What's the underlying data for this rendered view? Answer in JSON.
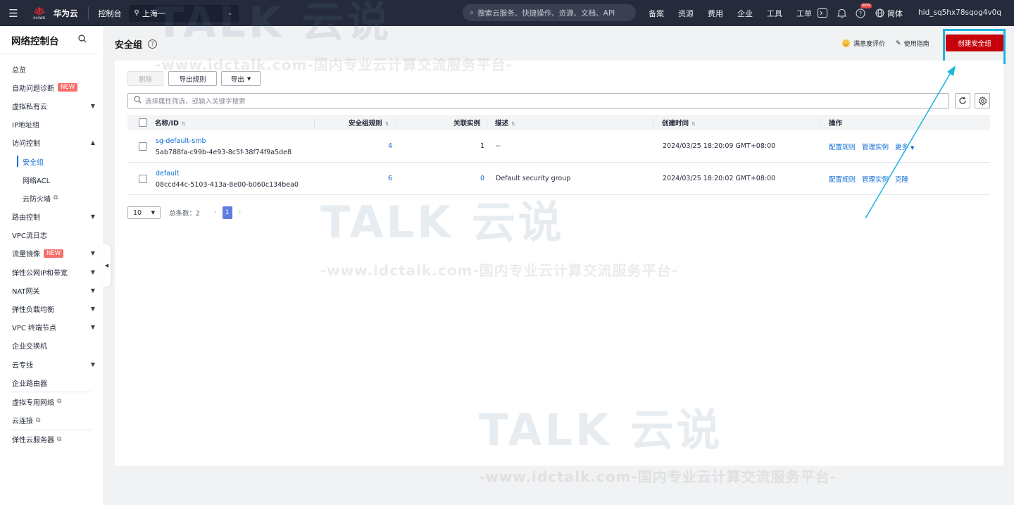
{
  "topbar": {
    "brand": "华为云",
    "logo_small": "HUAWEI",
    "console": "控制台",
    "region": "上海一",
    "search_placeholder": "搜索云服务、快捷操作、资源、文档、API",
    "links": [
      "备案",
      "资源",
      "费用",
      "企业",
      "工具",
      "工单"
    ],
    "icon_new_badge": "NEW",
    "language": "简体",
    "user": "hid_sq5hx78sqog4v0q"
  },
  "sidebar": {
    "title": "网络控制台",
    "items": [
      {
        "label": "总览"
      },
      {
        "label": "自助问题诊断",
        "badge": "NEW"
      },
      {
        "label": "虚拟私有云"
      },
      {
        "label": "IP地址组"
      },
      {
        "label": "访问控制"
      },
      {
        "label": "安全组"
      },
      {
        "label": "网络ACL"
      },
      {
        "label": "云防火墙"
      },
      {
        "label": "路由控制"
      },
      {
        "label": "VPC流日志"
      },
      {
        "label": "流量镜像",
        "badge": "NEW"
      },
      {
        "label": "弹性公网IP和带宽"
      },
      {
        "label": "NAT网关"
      },
      {
        "label": "弹性负载均衡"
      },
      {
        "label": "VPC 终端节点"
      },
      {
        "label": "企业交换机"
      },
      {
        "label": "云专线"
      },
      {
        "label": "企业路由器"
      },
      {
        "label": "虚拟专用网络"
      },
      {
        "label": "云连接"
      },
      {
        "label": "弹性云服务器"
      }
    ]
  },
  "page": {
    "title": "安全组",
    "satisfaction": "满意度评价",
    "guide": "使用指南",
    "create_button": "创建安全组"
  },
  "toolbar": {
    "delete": "删除",
    "export_rules": "导出规则",
    "export": "导出",
    "search_placeholder": "选择属性筛选，或输入关键字搜索"
  },
  "table": {
    "headers": {
      "name": "名称/ID",
      "rules": "安全组规则",
      "instances": "关联实例",
      "desc": "描述",
      "created": "创建时间",
      "ops": "操作"
    },
    "rows": [
      {
        "name": "sg-default-smb",
        "id": "5ab788fa-c99b-4e93-8c5f-38f74f9a5de8",
        "rules": "4",
        "instances": "1",
        "desc": "--",
        "created": "2024/03/25 18:20:09 GMT+08:00",
        "op1": "配置规则",
        "op2": "管理实例",
        "op3": "更多"
      },
      {
        "name": "default",
        "id": "08ccd44c-5103-413a-8e00-b060c134bea0",
        "rules": "6",
        "instances": "0",
        "desc": "Default security group",
        "created": "2024/03/25 18:20:02 GMT+08:00",
        "op1": "配置规则",
        "op2": "管理实例",
        "op3": "克隆"
      }
    ]
  },
  "pager": {
    "page_size": "10",
    "total": "总条数：2",
    "current": "1"
  },
  "watermark": {
    "logo": "TALK 云说",
    "line": "-www.idctalk.com-国内专业云计算交流服务平台-"
  },
  "colors": {
    "topbar": "#252b3a",
    "brand_red": "#c7000b",
    "link": "#0d6bd6",
    "highlight": "#1cb5e0"
  }
}
